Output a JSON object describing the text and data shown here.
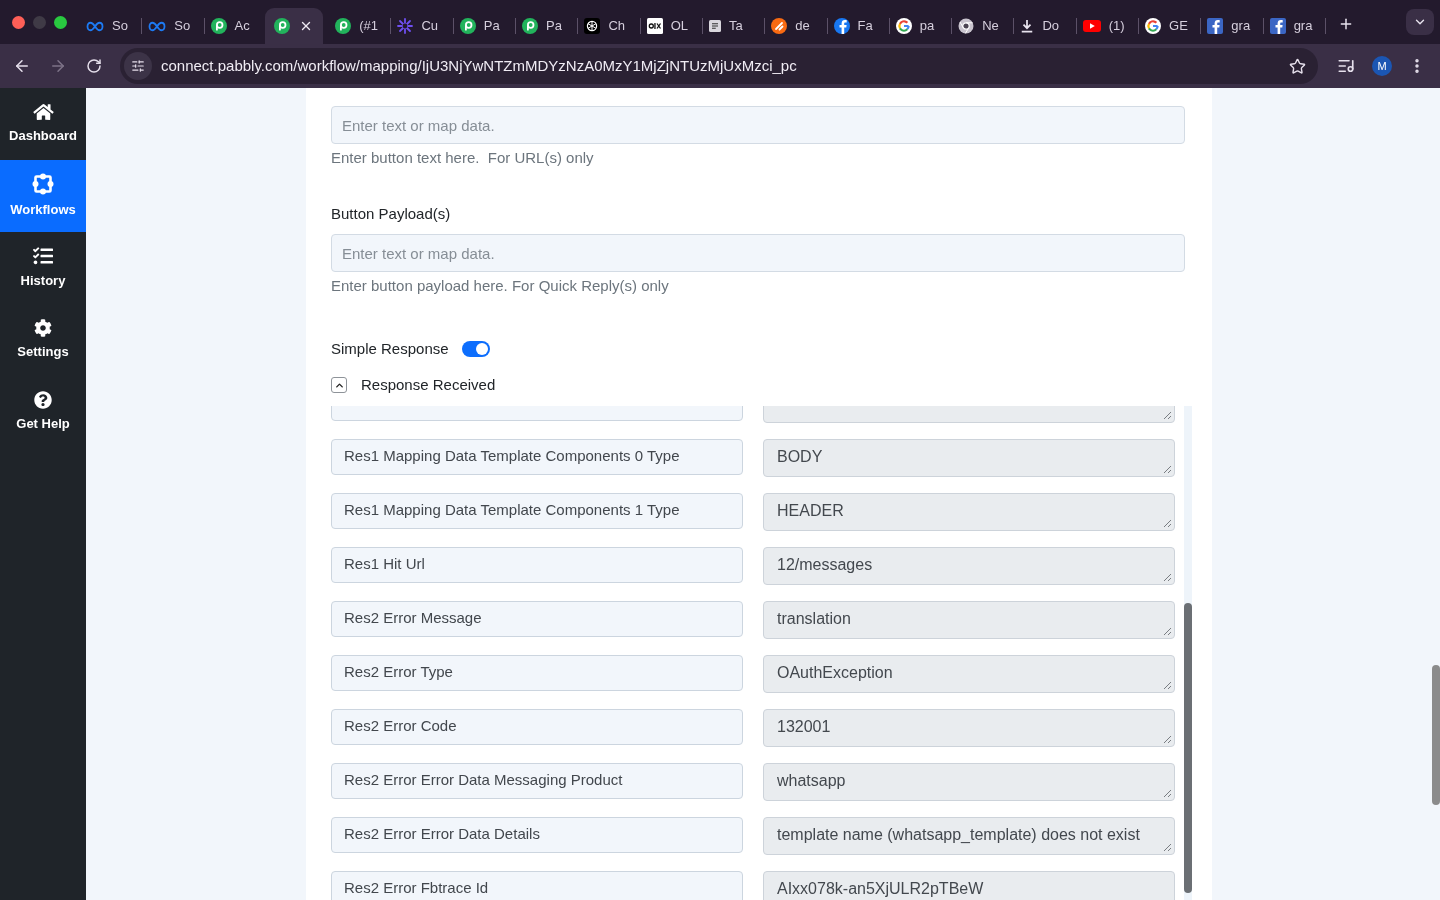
{
  "browser": {
    "tabs": [
      {
        "title": "So",
        "kind": "infinity",
        "selected": false
      },
      {
        "title": "So",
        "kind": "infinity",
        "selected": false
      },
      {
        "title": "Ac",
        "kind": "pcircle",
        "selected": false
      },
      {
        "kind": "pcircle",
        "selected": true
      },
      {
        "title": "(#1",
        "kind": "pcircle",
        "selected": false
      },
      {
        "title": "Cu",
        "kind": "sunburst",
        "selected": false
      },
      {
        "title": "Pa",
        "kind": "pcircle",
        "selected": false
      },
      {
        "title": "Pa",
        "kind": "pcircle",
        "selected": false
      },
      {
        "title": "Ch",
        "kind": "knot",
        "selected": false
      },
      {
        "title": "OL",
        "kind": "square",
        "selected": false
      },
      {
        "title": "Ta",
        "kind": "note",
        "selected": false
      },
      {
        "title": "de",
        "kind": "orangedisc",
        "selected": false
      },
      {
        "title": "Fa",
        "kind": "fcircle",
        "selected": false
      },
      {
        "title": "pa",
        "kind": "gmark",
        "selected": false
      },
      {
        "title": "Ne",
        "kind": "wheel",
        "selected": false
      },
      {
        "title": "Do",
        "kind": "download",
        "selected": false
      },
      {
        "title": "(1)",
        "kind": "play",
        "selected": false
      },
      {
        "title": "GE",
        "kind": "gmark",
        "selected": false
      },
      {
        "title": "gra",
        "kind": "fsquare",
        "selected": false
      },
      {
        "title": "gra",
        "kind": "fsquare",
        "selected": false
      }
    ],
    "nav": {
      "back": {
        "disabled": false
      },
      "forward": {
        "disabled": true
      }
    },
    "url": "connect.pabbly.com/workflow/mapping/IjU3NjYwNTZmMDYzNzA0MzY1MjZjNTUzMjUxMzci_pc",
    "profile": {
      "initial": "M"
    }
  },
  "sidebar": {
    "items": [
      {
        "label": "Dashboard",
        "kind": "home",
        "selected": false
      },
      {
        "label": "Workflows",
        "kind": "workflow",
        "selected": true
      },
      {
        "label": "History",
        "kind": "list",
        "selected": false
      },
      {
        "label": "Settings",
        "kind": "gear",
        "selected": false
      },
      {
        "label": "Get Help",
        "kind": "help",
        "selected": false
      }
    ]
  },
  "form": {
    "fields": [
      {
        "placeholder": "Enter text or map data.",
        "help": "Enter button text here.  For URL(s) only"
      },
      {
        "label": "Button Payload(s)",
        "placeholder": "Enter text or map data.",
        "help": "Enter button payload here. For Quick Reply(s) only"
      }
    ],
    "simple_response": {
      "label": "Simple Response",
      "on": true
    },
    "response_received": {
      "label": "Response Received",
      "expanded": true
    },
    "rows": [
      {
        "key": "Res1 Mapping Data Template Components 0 Type",
        "value": "BODY"
      },
      {
        "key": "Res1 Mapping Data Template Components 1 Type",
        "value": "HEADER"
      },
      {
        "key": "Res1 Hit Url",
        "value": "12/messages"
      },
      {
        "key": "Res2 Error Message",
        "value": "translation"
      },
      {
        "key": "Res2 Error Type",
        "value": "OAuthException"
      },
      {
        "key": "Res2 Error Code",
        "value": "132001"
      },
      {
        "key": "Res2 Error Error Data Messaging Product",
        "value": "whatsapp"
      },
      {
        "key": "Res2 Error Error Data Details",
        "value": "template name (whatsapp_template) does not exist"
      },
      {
        "key": "Res2 Error Fbtrace Id",
        "value": "AIxx078k-an5XjULR2pTBeW"
      }
    ]
  }
}
